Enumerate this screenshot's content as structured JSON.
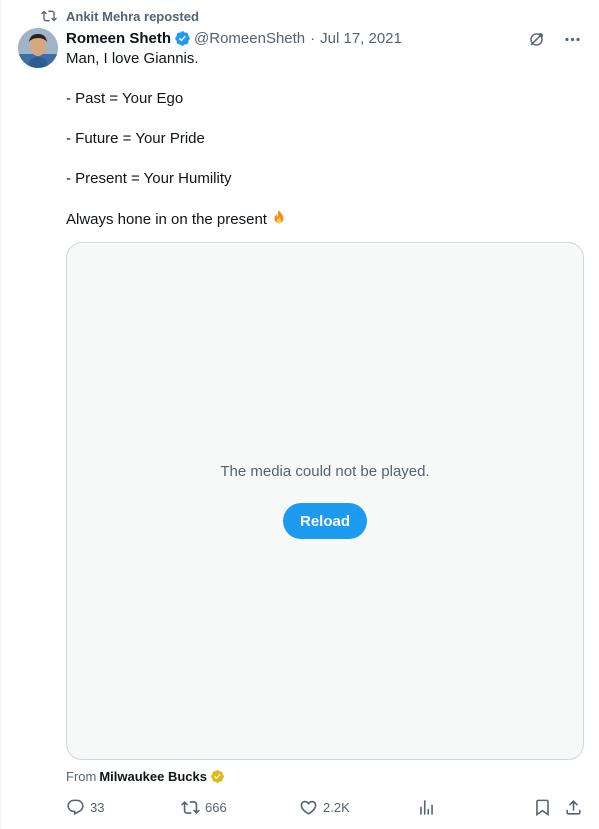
{
  "repost": {
    "icon": "repost-icon",
    "text": "Ankit Mehra reposted"
  },
  "author": {
    "name": "Romeen Sheth",
    "handle": "@RomeenSheth",
    "separator": "·",
    "date": "Jul 17, 2021",
    "verified_color": "#1d9bf0"
  },
  "header_actions": {
    "grok_icon": "grok-icon",
    "more_icon": "more-icon"
  },
  "tweet": {
    "lines": [
      "Man, I love Giannis.",
      "- Past = Your Ego",
      "- Future = Your Pride",
      "- Present = Your Humility",
      "Always hone in on the present"
    ],
    "emoji": "fire-emoji"
  },
  "media": {
    "message": "The media could not be played.",
    "reload_label": "Reload",
    "accent": "#1d9bf0"
  },
  "source": {
    "prefix": "From",
    "name": "Milwaukee Bucks",
    "badge_color": "#e2b719"
  },
  "actions": {
    "replies": "33",
    "reposts": "666",
    "likes": "2.2K"
  }
}
